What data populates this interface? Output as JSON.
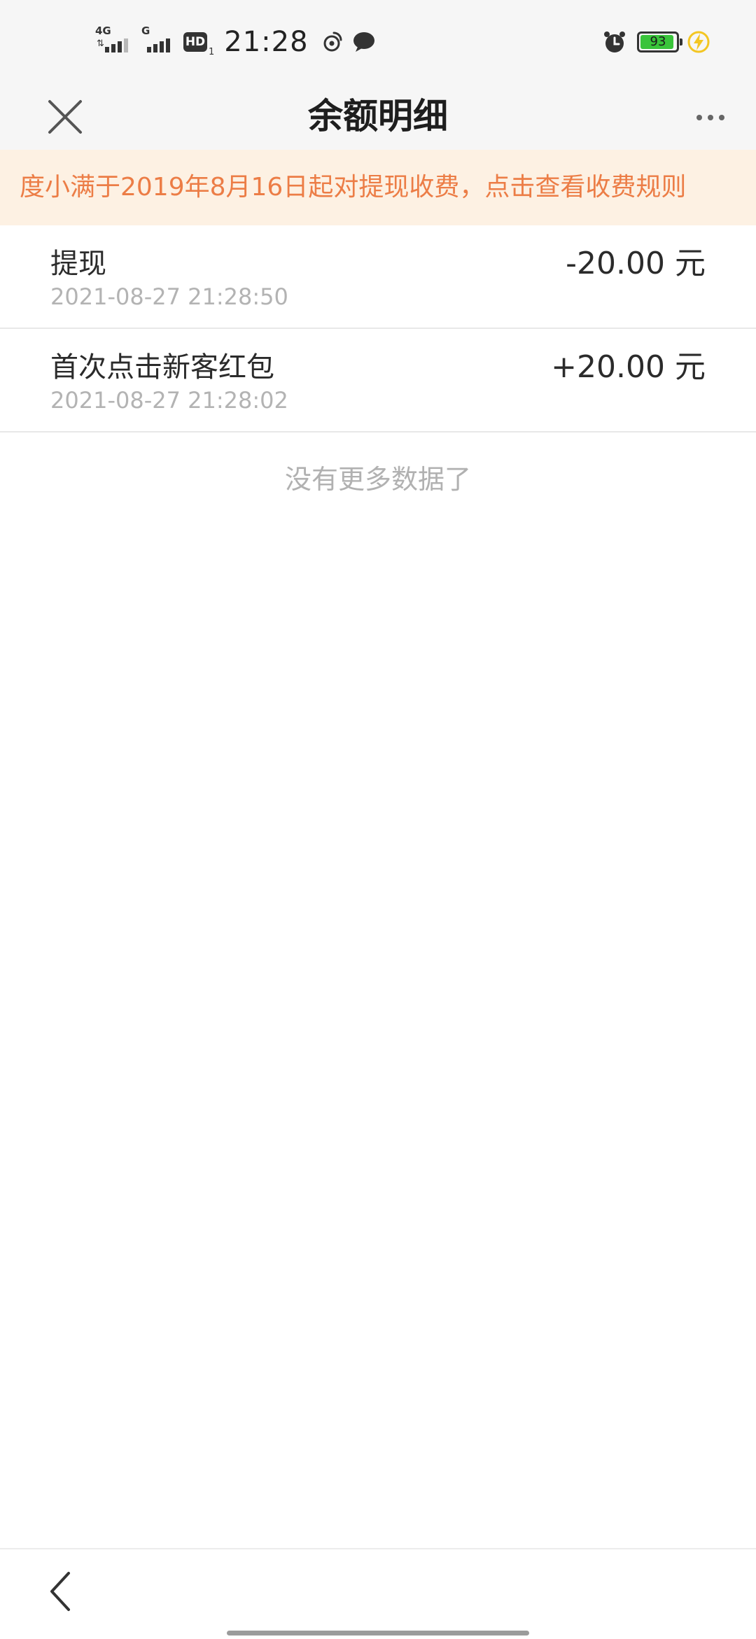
{
  "status_bar": {
    "network_1": "4G",
    "network_2": "G",
    "hd_label": "HD",
    "hd_sub": "1",
    "time": "21:28",
    "battery_percent": "93",
    "battery_level": 0.93,
    "colors": {
      "battery_fill": "#39c43a",
      "charging": "#f3c623"
    },
    "icons": [
      "weibo-icon",
      "chat-bubble-icon",
      "alarm-clock-icon",
      "charging-bolt-icon"
    ]
  },
  "nav": {
    "title": "余额明细",
    "close_icon": "close-icon",
    "more_icon": "more-dots-icon"
  },
  "notice": {
    "text": "度小满于2019年8月16日起对提现收费，点击查看收费规则",
    "color": "#ec7d46",
    "background": "#fdf1e3"
  },
  "transactions": [
    {
      "title": "提现",
      "time": "2021-08-27 21:28:50",
      "amount": "-20.00 元"
    },
    {
      "title": "首次点击新客红包",
      "time": "2021-08-27 21:28:02",
      "amount": "+20.00 元"
    }
  ],
  "list_footer": "没有更多数据了",
  "bottom_bar": {
    "back_icon": "chevron-left-icon"
  }
}
